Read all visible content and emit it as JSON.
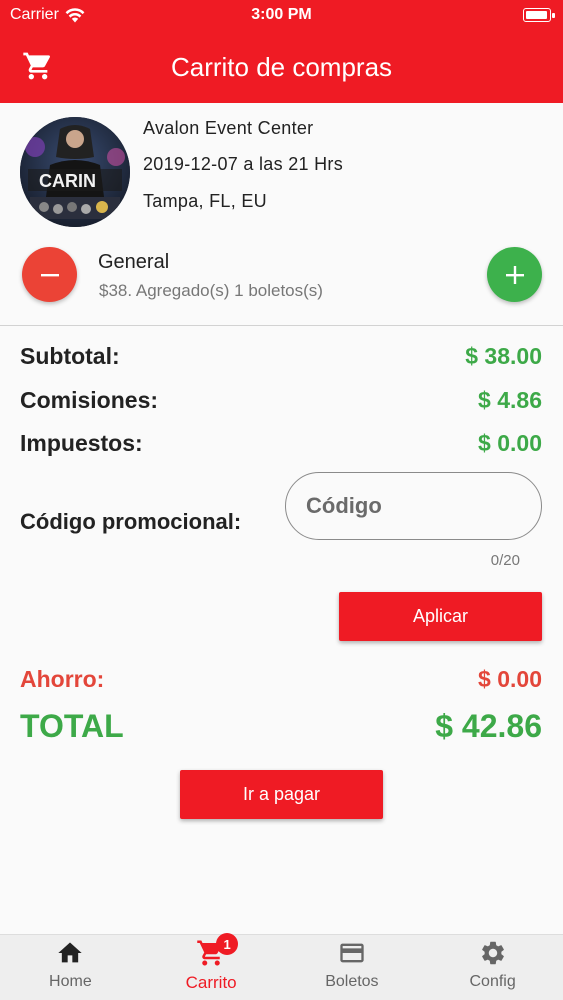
{
  "status_bar": {
    "carrier": "Carrier",
    "time": "3:00 PM",
    "battery_level": 1.0
  },
  "header": {
    "title": "Carrito de compras",
    "icon": "cart-icon"
  },
  "event": {
    "venue": "Avalon Event Center",
    "datetime": "2019-12-07 a las 21 Hrs",
    "location": "Tampa, FL, EU",
    "poster_text": "CARIN"
  },
  "ticket": {
    "name": "General",
    "description": "$38. Agregado(s) 1 boletos(s)",
    "decrease_icon": "minus-icon",
    "increase_icon": "plus-icon"
  },
  "summary": {
    "subtotal_label": "Subtotal:",
    "subtotal_value": "$ 38.00",
    "fees_label": "Comisiones:",
    "fees_value": "$ 4.86",
    "taxes_label": "Impuestos:",
    "taxes_value": "$ 0.00"
  },
  "promo": {
    "label": "Código promocional:",
    "placeholder": "Código",
    "value": "",
    "counter": "0/20",
    "apply_label": "Aplicar"
  },
  "savings": {
    "label": "Ahorro:",
    "value": "$ 0.00"
  },
  "total": {
    "label": "TOTAL",
    "value": "$ 42.86"
  },
  "pay_button": {
    "label": "Ir a pagar"
  },
  "tabs": [
    {
      "label": "Home",
      "icon": "home-icon"
    },
    {
      "label": "Carrito",
      "icon": "cart-icon",
      "badge": "1",
      "active": true
    },
    {
      "label": "Boletos",
      "icon": "card-icon"
    },
    {
      "label": "Config",
      "icon": "gear-icon"
    }
  ],
  "colors": {
    "brand_red": "#ef1b24",
    "green": "#3da948",
    "savings_red": "#e3463a",
    "minus_red": "#eb4336",
    "plus_green": "#3db14c"
  }
}
